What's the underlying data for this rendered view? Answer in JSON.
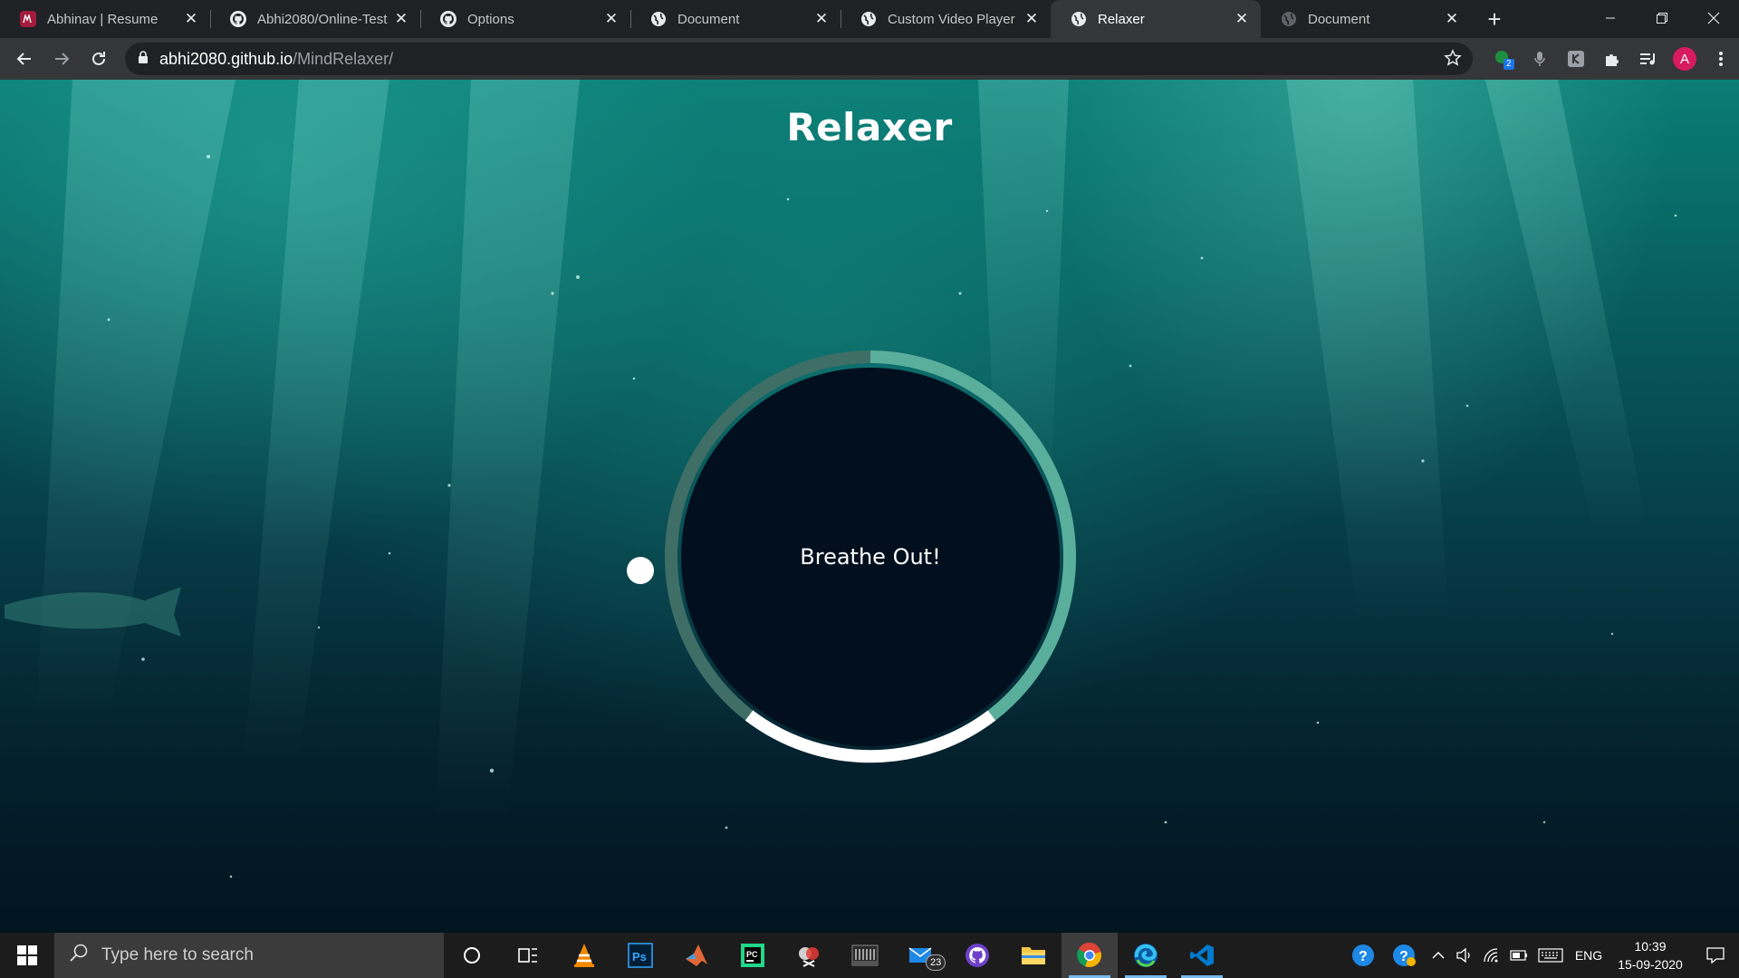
{
  "browser": {
    "tabs": [
      {
        "title": "Abhinav | Resume",
        "icon": "resume-favicon",
        "active": false
      },
      {
        "title": "Abhi2080/Online-Test",
        "icon": "github-icon",
        "active": false
      },
      {
        "title": "Options",
        "icon": "github-icon",
        "active": false
      },
      {
        "title": "Document",
        "icon": "globe-icon",
        "active": false
      },
      {
        "title": "Custom Video Player",
        "icon": "globe-icon",
        "active": false
      },
      {
        "title": "Relaxer",
        "icon": "globe-icon",
        "active": true
      },
      {
        "title": "Document",
        "icon": "globe-icon",
        "active": false
      }
    ],
    "url_host": "abhi2080.github.io",
    "url_path": "/MindRelaxer/",
    "extension_badge": "2",
    "profile_initial": "A"
  },
  "page": {
    "title": "Relaxer",
    "breath_text": "Breathe Out!"
  },
  "taskbar": {
    "search_placeholder": "Type here to search",
    "mail_badge": "23",
    "language": "ENG",
    "time": "10:39",
    "date": "15-09-2020"
  },
  "colors": {
    "ring_dark": "#3f6e66",
    "ring_light": "#5aaf9c",
    "ring_white": "#ffffff",
    "inner_circle": "#010f1e",
    "ocean_top": "#0a7d75",
    "ocean_bottom": "#021520"
  }
}
